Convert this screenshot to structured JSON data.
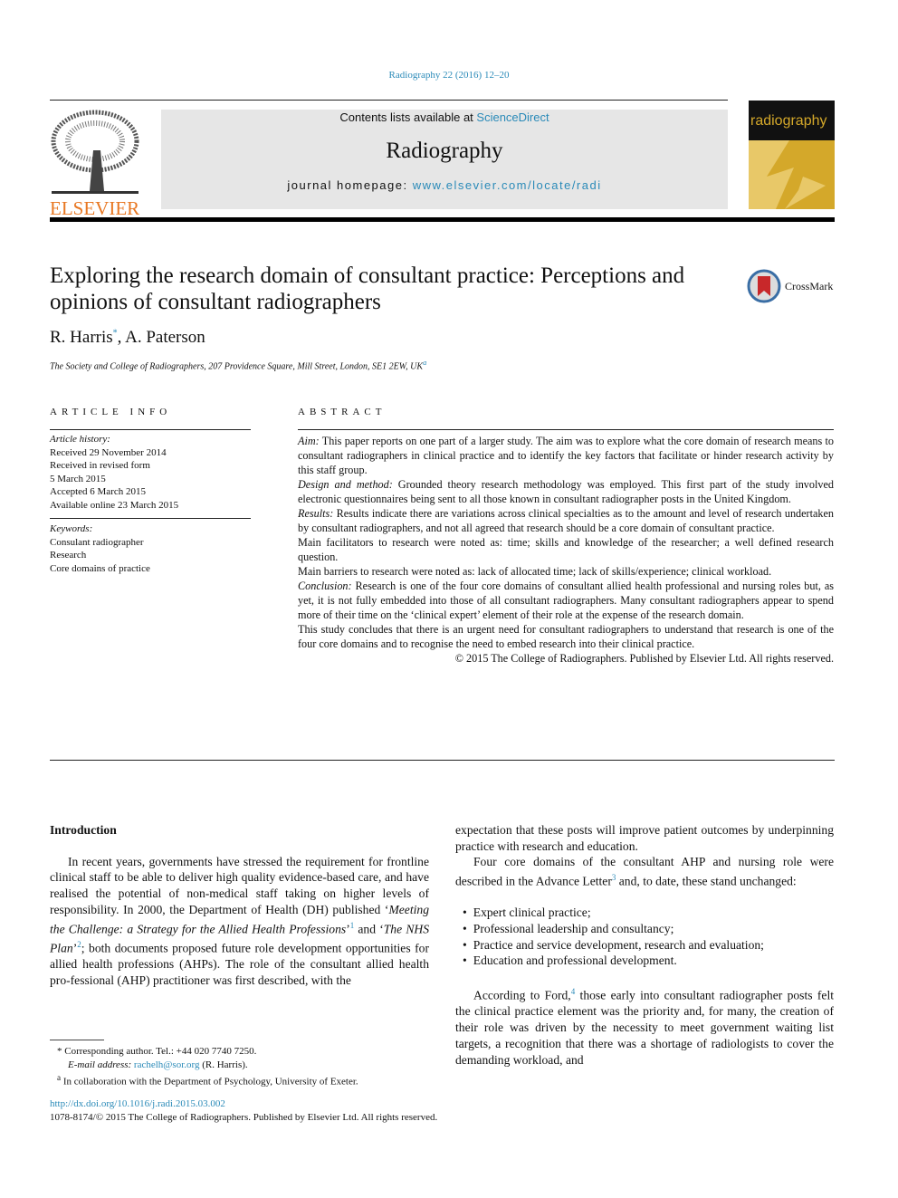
{
  "header": {
    "citation": "Radiography 22 (2016) 12–20",
    "contents_prefix": "Contents lists available at ",
    "contents_link": "ScienceDirect",
    "journal": "Radiography",
    "homepage_prefix": "journal homepage: ",
    "homepage_link": "www.elsevier.com/locate/radi",
    "publisher_logo": "ELSEVIER",
    "cover_title": "radiography"
  },
  "article": {
    "title": "Exploring the research domain of consultant practice: Perceptions and opinions of consultant radiographers",
    "crossmark": "CrossMark",
    "authors": [
      {
        "name": "R. Harris",
        "mark": "*"
      },
      {
        "name": "A. Paterson",
        "mark": ""
      }
    ],
    "affiliation": "The Society and College of Radiographers, 207 Providence Square, Mill Street, London, SE1 2EW, UK",
    "affiliation_mark": "a"
  },
  "article_info": {
    "heading": "ARTICLE INFO",
    "history_label": "Article history:",
    "history": [
      "Received 29 November 2014",
      "Received in revised form",
      "5 March 2015",
      "Accepted 6 March 2015",
      "Available online 23 March 2015"
    ],
    "keywords_label": "Keywords:",
    "keywords": [
      "Consulant radiographer",
      "Research",
      "Core domains of practice"
    ]
  },
  "abstract": {
    "heading": "ABSTRACT",
    "paras": [
      {
        "label": "Aim:",
        "text": " This paper reports on one part of a larger study. The aim was to explore what the core domain of research means to consultant radiographers in clinical practice and to identify the key factors that facilitate or hinder research activity by this staff group."
      },
      {
        "label": "Design and method:",
        "text": " Grounded theory research methodology was employed. This first part of the study involved electronic questionnaires being sent to all those known in consultant radiographer posts in the United Kingdom."
      },
      {
        "label": "Results:",
        "text": " Results indicate there are variations across clinical specialties as to the amount and level of research undertaken by consultant radiographers, and not all agreed that research should be a core domain of consultant practice."
      },
      {
        "label": "",
        "text": "Main facilitators to research were noted as: time; skills and knowledge of the researcher; a well defined research question."
      },
      {
        "label": "",
        "text": "Main barriers to research were noted as: lack of allocated time; lack of skills/experience; clinical workload."
      },
      {
        "label": "Conclusion:",
        "text": " Research is one of the four core domains of consultant allied health professional and nursing roles but, as yet, it is not fully embedded into those of all consultant radiographers. Many consultant radiographers appear to spend more of their time on the ‘clinical expert’ element of their role at the expense of the research domain."
      },
      {
        "label": "",
        "text": "This study concludes that there is an urgent need for consultant radiographers to understand that research is one of the four core domains and to recognise the need to embed research into their clinical practice."
      }
    ],
    "copyright": "© 2015 The College of Radiographers. Published by Elsevier Ltd. All rights reserved."
  },
  "body": {
    "heading": "Introduction",
    "p1": {
      "a": "In recent years, governments have stressed the requirement for frontline clinical staff to be able to deliver high quality evidence-based care, and have realised the potential of non-medical staff taking on higher levels of responsibility. In 2000, the Department of Health (DH) published ‘",
      "i1": "Meeting the Challenge: a Strategy for the Allied Health Professions",
      "b": "’",
      "s1": "1",
      "c": " and ‘",
      "i2": "The NHS Plan",
      "d": "’",
      "s2": "2",
      "e": "; both documents proposed future role development opportunities for allied health professions (AHPs). The role of the consultant allied health pro-fessional (AHP) practitioner was first described, with the"
    },
    "p2": "expectation that these posts will improve patient outcomes by underpinning practice with research and education.",
    "p3": {
      "a": "Four core domains of the consultant AHP and nursing role were described in the Advance Letter",
      "s": "3",
      "b": " and, to date, these stand unchanged:"
    },
    "bullets": [
      "Expert clinical practice;",
      "Professional leadership and consultancy;",
      "Practice and service development, research and evaluation;",
      "Education and professional development."
    ],
    "p4": {
      "a": "According to Ford,",
      "s": "4",
      "b": " those early into consultant radiographer posts felt the clinical practice element was the priority and, for many, the creation of their role was driven by the necessity to meet government waiting list targets, a recognition that there was a shortage of radiologists to cover the demanding workload, and"
    }
  },
  "footnotes": {
    "corr": "* Corresponding author. Tel.: +44 020 7740 7250.",
    "email_label": "E-mail address: ",
    "email": "rachelh@sor.org",
    "email_suffix": " (R. Harris).",
    "a_mark": "a",
    "a_text": "In collaboration with the Department of Psychology, University of Exeter."
  },
  "footer": {
    "doi": "http://dx.doi.org/10.1016/j.radi.2015.03.002",
    "issn": "1078-8174/© 2015 The College of Radiographers. Published by Elsevier Ltd. All rights reserved."
  },
  "colors": {
    "link": "#2a8ab8",
    "elsevier_orange": "#e87722",
    "cover_gold": "#d4a82a"
  }
}
